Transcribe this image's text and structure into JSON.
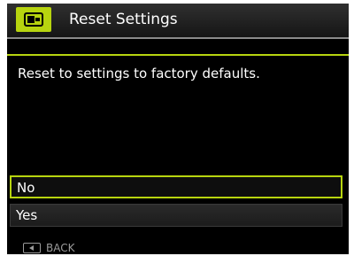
{
  "header": {
    "title": "Reset Settings",
    "mode_icon": "setup-tab-icon"
  },
  "message": "Reset to settings to factory defaults.",
  "options": [
    {
      "label": "No",
      "selected": true
    },
    {
      "label": "Yes",
      "selected": false
    }
  ],
  "footer": {
    "back_label": "BACK",
    "back_icon": "left-arrow-button-icon"
  },
  "colors": {
    "accent": "#b7d40f",
    "background": "#000000",
    "text": "#ffffff",
    "muted": "#9a9a9a"
  }
}
